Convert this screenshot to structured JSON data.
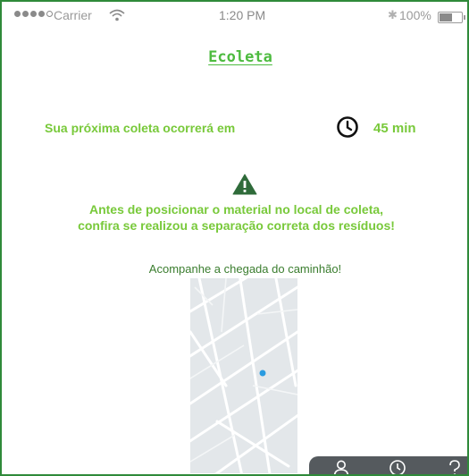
{
  "status_bar": {
    "carrier": "Carrier",
    "time": "1:20 PM",
    "battery": "100%"
  },
  "app": {
    "title": "Ecoleta"
  },
  "next_collection": {
    "label": "Sua próxima coleta ocorrerá em",
    "time": "45 min"
  },
  "warning": {
    "line1": "Antes de posicionar o material no local de coleta,",
    "line2": "confira se realizou a separação correta dos resíduos!"
  },
  "tracking": {
    "label": "Acompanhe a chegada do caminhão!"
  },
  "tab_bar": {
    "items": [
      {
        "icon": "user-icon"
      },
      {
        "icon": "clock-icon"
      },
      {
        "icon": "help-icon"
      }
    ]
  },
  "colors": {
    "frame": "#2f8a3a",
    "title": "#4dbb3f",
    "text_accent": "#78c93a",
    "track_text": "#3a7d2e",
    "tabbar": "#555a5e",
    "location_dot": "#2a9be0"
  }
}
